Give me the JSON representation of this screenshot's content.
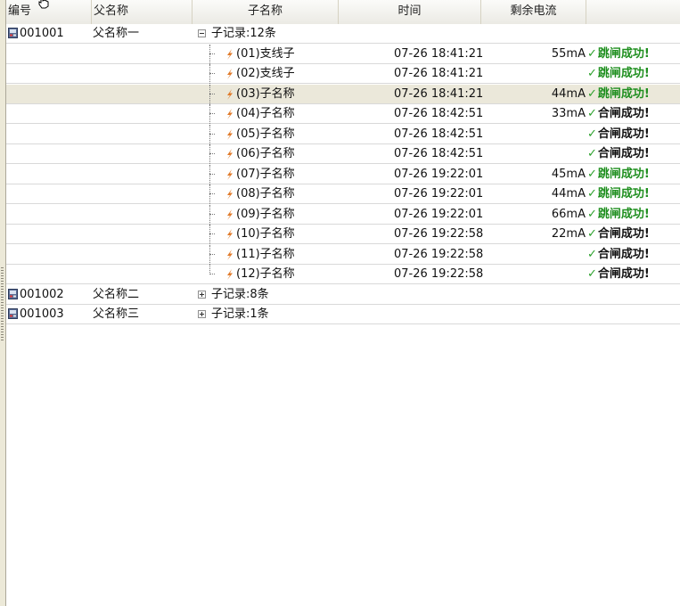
{
  "columns": {
    "code": "编号",
    "parent_name": "父名称",
    "child_name": "子名称",
    "time": "时间",
    "residual_current": "剩余电流"
  },
  "icons": {
    "parent": "device-icon",
    "child": "lightning-bolt-icon",
    "success": "checkmark-icon",
    "collapse": "minus-box-icon",
    "expand": "plus-box-icon"
  },
  "colors": {
    "trip_success": "#1f8f1f",
    "close_success": "#111111",
    "selected_row": "#ebe8da",
    "bolt": "#e07a2a"
  },
  "parents": [
    {
      "code": "001001",
      "name": "父名称一",
      "summary": "子记录:12条",
      "expanded": true,
      "children": [
        {
          "name": "(01)支线子",
          "time": "07-26 18:41:21",
          "current": "55mA",
          "result": "跳闸成功!",
          "result_type": "trip",
          "selected": false
        },
        {
          "name": "(02)支线子",
          "time": "07-26 18:41:21",
          "current": "",
          "result": "跳闸成功!",
          "result_type": "trip",
          "selected": false
        },
        {
          "name": "(03)子名称",
          "time": "07-26 18:41:21",
          "current": "44mA",
          "result": "跳闸成功!",
          "result_type": "trip",
          "selected": true
        },
        {
          "name": "(04)子名称",
          "time": "07-26 18:42:51",
          "current": "33mA",
          "result": "合闸成功!",
          "result_type": "close",
          "selected": false
        },
        {
          "name": "(05)子名称",
          "time": "07-26 18:42:51",
          "current": "",
          "result": "合闸成功!",
          "result_type": "close",
          "selected": false
        },
        {
          "name": "(06)子名称",
          "time": "07-26 18:42:51",
          "current": "",
          "result": "合闸成功!",
          "result_type": "close",
          "selected": false
        },
        {
          "name": "(07)子名称",
          "time": "07-26 19:22:01",
          "current": "45mA",
          "result": "跳闸成功!",
          "result_type": "trip",
          "selected": false
        },
        {
          "name": "(08)子名称",
          "time": "07-26 19:22:01",
          "current": "44mA",
          "result": "跳闸成功!",
          "result_type": "trip",
          "selected": false
        },
        {
          "name": "(09)子名称",
          "time": "07-26 19:22:01",
          "current": "66mA",
          "result": "跳闸成功!",
          "result_type": "trip",
          "selected": false
        },
        {
          "name": "(10)子名称",
          "time": "07-26 19:22:58",
          "current": "22mA",
          "result": "合闸成功!",
          "result_type": "close",
          "selected": false
        },
        {
          "name": "(11)子名称",
          "time": "07-26 19:22:58",
          "current": "",
          "result": "合闸成功!",
          "result_type": "close",
          "selected": false
        },
        {
          "name": "(12)子名称",
          "time": "07-26 19:22:58",
          "current": "",
          "result": "合闸成功!",
          "result_type": "close",
          "selected": false
        }
      ]
    },
    {
      "code": "001002",
      "name": "父名称二",
      "summary": "子记录:8条",
      "expanded": false,
      "children": []
    },
    {
      "code": "001003",
      "name": "父名称三",
      "summary": "子记录:1条",
      "expanded": false,
      "children": []
    }
  ]
}
